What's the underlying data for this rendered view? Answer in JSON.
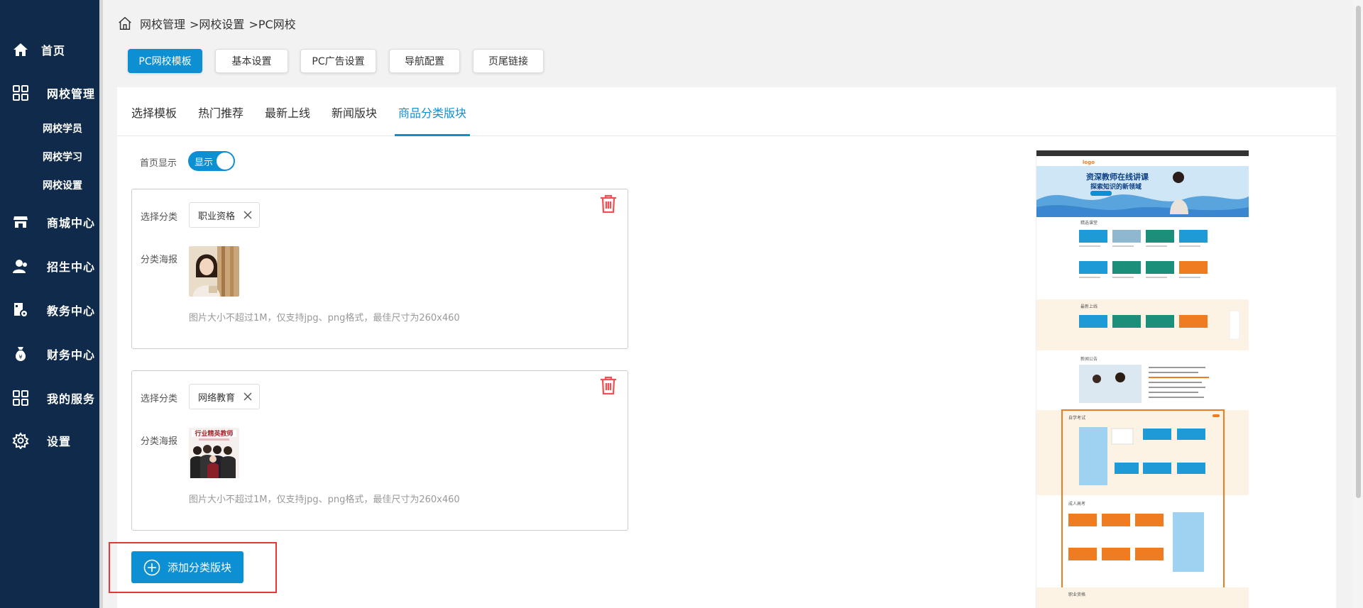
{
  "sidebar": {
    "items": [
      {
        "label": "首页",
        "icon": "home-icon"
      },
      {
        "label": "网校管理",
        "icon": "grid-icon"
      },
      {
        "label": "商城中心",
        "icon": "store-icon"
      },
      {
        "label": "招生中心",
        "icon": "users-icon"
      },
      {
        "label": "教务中心",
        "icon": "doc-gear-icon"
      },
      {
        "label": "财务中心",
        "icon": "money-bag-icon"
      },
      {
        "label": "我的服务",
        "icon": "grid-icon"
      },
      {
        "label": "设置",
        "icon": "gear-icon"
      }
    ],
    "sub_items": [
      "网校学员",
      "网校学习",
      "网校设置"
    ]
  },
  "breadcrumb": {
    "part1": "网校管理",
    "part2": ">网校设置",
    "part3": ">PC网校"
  },
  "top_buttons": [
    "PC网校模板",
    "基本设置",
    "PC广告设置",
    "导航配置",
    "页尾链接"
  ],
  "tabs": [
    "选择模板",
    "热门推荐",
    "最新上线",
    "新闻版块",
    "商品分类版块"
  ],
  "homepage_display": {
    "label": "首页显示",
    "toggle_text": "显示",
    "on": true
  },
  "categories": [
    {
      "select_label": "选择分类",
      "value": "职业资格",
      "poster_label": "分类海报",
      "hint": "图片大小不超过1M，仅支持jpg、png格式，最佳尺寸为260x460"
    },
    {
      "select_label": "选择分类",
      "value": "网络教育",
      "poster_label": "分类海报",
      "hint": "图片大小不超过1M，仅支持jpg、png格式，最佳尺寸为260x460",
      "poster_caption": "行业精英教师"
    }
  ],
  "add_button": {
    "label": "添加分类版块"
  },
  "preview": {
    "logo": "logo",
    "banner_line1": "资深教师在线讲课",
    "banner_line2": "探索知识的新领域",
    "section_titles": [
      "精选课堂",
      "最新上线",
      "新闻公告",
      "自学考试",
      "成人高考",
      "职业资格"
    ]
  },
  "colors": {
    "sidebar": "#0f2a4a",
    "primary": "#0d8fd4",
    "danger": "#e53935",
    "trash": "#f05050"
  }
}
